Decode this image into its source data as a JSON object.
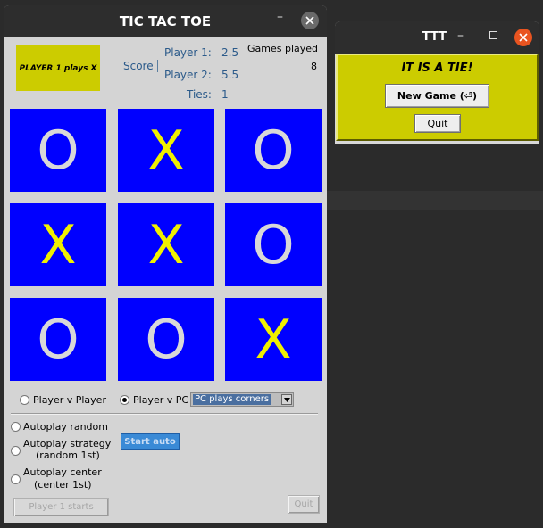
{
  "main_window": {
    "title": "TIC TAC TOE",
    "minimize_glyph": "–",
    "player_turn_text": "PLAYER 1 plays X",
    "score_label": "Score",
    "player1_label": "Player 1:",
    "player1_score": "2.5",
    "player2_label": "Player 2:",
    "player2_score": "5.5",
    "ties_label": "Ties:",
    "ties_value": "1",
    "games_played_label": "Games played",
    "games_played_value": "8",
    "board": {
      "cells": [
        "O",
        "X",
        "O",
        "X",
        "X",
        "O",
        "O",
        "O",
        "X"
      ],
      "x_color": "#f0f000",
      "o_color": "#d8d8d8",
      "cell_color": "#0000ff"
    },
    "mode": {
      "pvp_label": "Player v Player",
      "pvc_label": "Player v PC",
      "selected": "pvc",
      "pc_option": "PC plays corners"
    },
    "autoplay": {
      "random_label": "Autoplay random",
      "strategy_label_line1": "Autoplay strategy",
      "strategy_label_line2": "(random 1st)",
      "center_label_line1": "Autoplay center",
      "center_label_line2": "(center 1st)",
      "start_auto_label": "Start auto"
    },
    "player1_starts_label": "Player 1 starts",
    "quit_label": "Quit"
  },
  "tie_dialog": {
    "title": "TTT",
    "minimize_glyph": "–",
    "message": "IT IS A TIE!",
    "new_game_label": "New Game (⏎)",
    "quit_label": "Quit",
    "panel_color": "#cccc00",
    "close_color": "#e95420"
  }
}
